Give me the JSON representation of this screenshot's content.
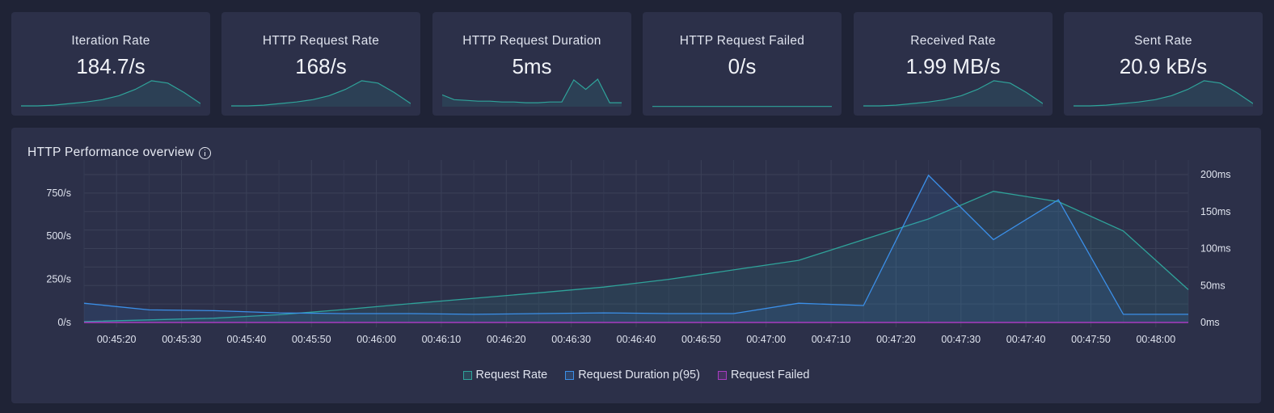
{
  "cards": [
    {
      "title": "Iteration Rate",
      "value": "184.7/s",
      "spark": [
        1,
        1,
        2,
        4,
        6,
        9,
        14,
        22,
        33,
        30,
        18,
        4
      ],
      "color": "#2fa39a"
    },
    {
      "title": "HTTP Request Rate",
      "value": "168/s",
      "spark": [
        1,
        1,
        2,
        4,
        6,
        9,
        14,
        22,
        33,
        30,
        18,
        4
      ],
      "color": "#2fa39a"
    },
    {
      "title": "HTTP Request Duration",
      "value": "5ms",
      "spark": [
        15,
        9,
        8,
        7,
        7,
        6,
        6,
        5,
        5,
        6,
        6,
        34,
        22,
        35,
        5,
        5
      ],
      "color": "#2fa39a"
    },
    {
      "title": "HTTP Request Failed",
      "value": "0/s",
      "spark": [
        0.3,
        0.3,
        0.3,
        0.3,
        0.3,
        0.3,
        0.3,
        0.3,
        0.3,
        0.3,
        0.3,
        0.3
      ],
      "color": "#2fa39a"
    },
    {
      "title": "Received Rate",
      "value": "1.99 MB/s",
      "spark": [
        1,
        1,
        2,
        4,
        6,
        9,
        14,
        22,
        33,
        30,
        18,
        4
      ],
      "color": "#2fa39a"
    },
    {
      "title": "Sent Rate",
      "value": "20.9 kB/s",
      "spark": [
        1,
        1,
        2,
        4,
        6,
        9,
        14,
        22,
        33,
        30,
        18,
        4
      ],
      "color": "#2fa39a"
    }
  ],
  "panel": {
    "title": "HTTP Performance overview"
  },
  "chart_data": {
    "type": "line",
    "x": [
      "00:45:15",
      "00:45:25",
      "00:45:35",
      "00:45:45",
      "00:45:55",
      "00:46:05",
      "00:46:15",
      "00:46:25",
      "00:46:35",
      "00:46:45",
      "00:46:55",
      "00:47:05",
      "00:47:15",
      "00:47:25",
      "00:47:35",
      "00:47:45",
      "00:47:55",
      "00:48:05"
    ],
    "x_ticks": [
      "00:45:20",
      "00:45:30",
      "00:45:40",
      "00:45:50",
      "00:46:00",
      "00:46:10",
      "00:46:20",
      "00:46:30",
      "00:46:40",
      "00:46:50",
      "00:47:00",
      "00:47:10",
      "00:47:20",
      "00:47:30",
      "00:47:40",
      "00:47:50",
      "00:48:00"
    ],
    "y_left": {
      "ticks": [
        "0/s",
        "250/s",
        "500/s",
        "750/s"
      ],
      "tick_values": [
        0,
        250,
        500,
        750
      ],
      "range": [
        0,
        857
      ]
    },
    "y_right": {
      "ticks": [
        "0ms",
        "50ms",
        "100ms",
        "150ms",
        "200ms"
      ],
      "tick_values": [
        0,
        50,
        100,
        150,
        200
      ],
      "range": [
        0,
        200
      ]
    },
    "series": [
      {
        "name": "Request Rate",
        "axis": "left",
        "color": "#2fa39a",
        "values": [
          5,
          15,
          25,
          45,
          75,
          108,
          140,
          172,
          205,
          250,
          305,
          360,
          480,
          600,
          760,
          700,
          530,
          190
        ]
      },
      {
        "name": "Request Duration p(95)",
        "axis": "right",
        "color": "#3b8fe8",
        "values": [
          26,
          17,
          16,
          13,
          12,
          12,
          11,
          12,
          13,
          12,
          12,
          26,
          23,
          199,
          112,
          166,
          11,
          11
        ]
      },
      {
        "name": "Request Failed",
        "axis": "left",
        "color": "#a83cc0",
        "values": [
          0,
          0,
          0,
          0,
          0,
          0,
          0,
          0,
          0,
          0,
          0,
          0,
          0,
          0,
          0,
          0,
          0,
          0
        ]
      }
    ],
    "legend": "bottom-center"
  }
}
